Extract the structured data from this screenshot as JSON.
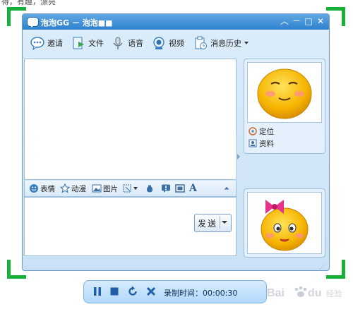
{
  "caption_top": "得，有趣，漂亮",
  "window": {
    "title": "泡泡GG － 泡泡■■",
    "controls": [
      "︿",
      "－",
      "□",
      "✕"
    ]
  },
  "toolbar": {
    "items": [
      {
        "label": "邀请",
        "icon": "invite-icon"
      },
      {
        "label": "文件",
        "icon": "file-icon"
      },
      {
        "label": "语音",
        "icon": "microphone-icon"
      },
      {
        "label": "视频",
        "icon": "camera-icon"
      },
      {
        "label": "消息历史",
        "icon": "history-icon"
      }
    ]
  },
  "chat_toolbar": {
    "emoji_label": "表情",
    "animation_label": "动漫",
    "image_label": "图片",
    "font_glyph": "A",
    "collapse_glyph": "⏶"
  },
  "send_button": {
    "label": "发送"
  },
  "side_panel": {
    "locate_label": "定位",
    "profile_label": "资料"
  },
  "recording": {
    "label": "录制时间：00:00:30"
  },
  "watermark": {
    "text": "Bai du 经验"
  },
  "colors": {
    "titlebar": "#3b8ad4",
    "frame_corner": "#19b03a",
    "rec_bar": "#c4e1fc"
  }
}
